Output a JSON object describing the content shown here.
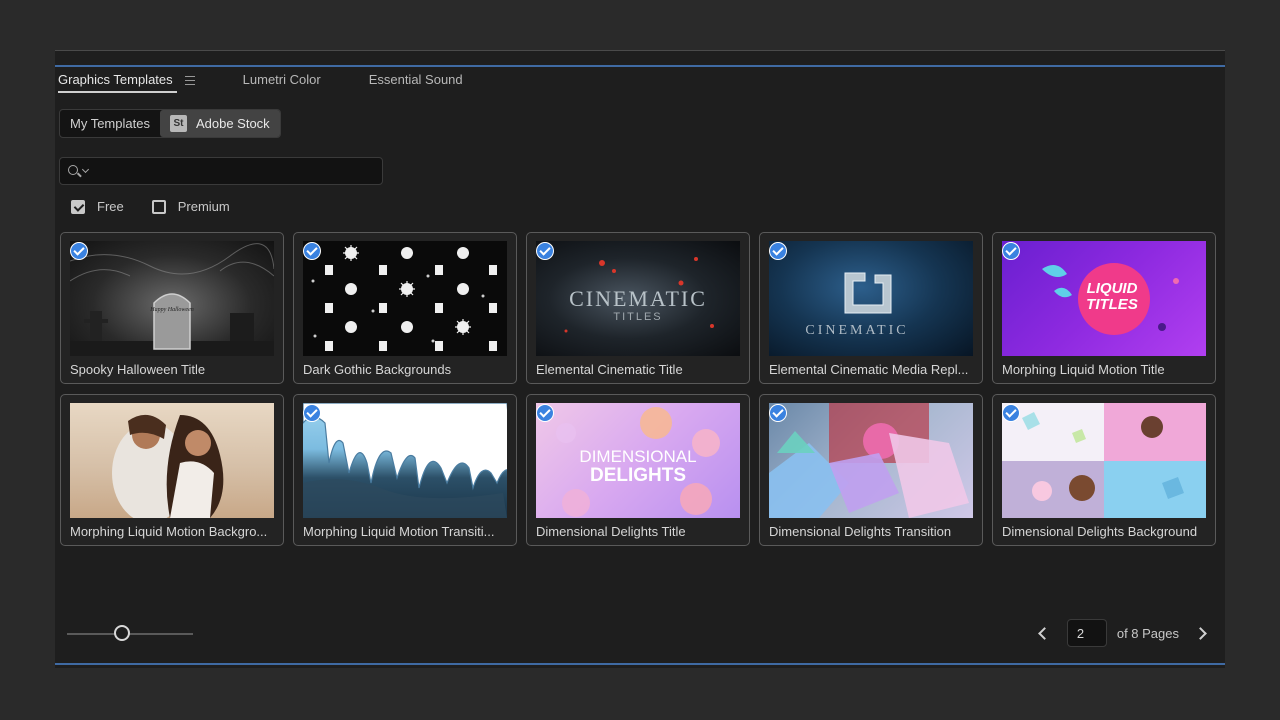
{
  "tabs": [
    {
      "label": "Graphics Templates"
    },
    {
      "label": "Lumetri Color"
    },
    {
      "label": "Essential Sound"
    }
  ],
  "source_toggle": {
    "my_templates": "My Templates",
    "adobe_stock_badge": "St",
    "adobe_stock": "Adobe Stock",
    "selected": "Adobe Stock"
  },
  "search": {
    "value": "",
    "placeholder": ""
  },
  "filters": {
    "free": {
      "label": "Free",
      "checked": true
    },
    "premium": {
      "label": "Premium",
      "checked": false
    }
  },
  "templates": [
    {
      "title": "Spooky Halloween Title",
      "selected": true,
      "thumb_text": "Happy Halloween"
    },
    {
      "title": "Dark Gothic Backgrounds",
      "selected": true
    },
    {
      "title": "Elemental Cinematic Title",
      "selected": true,
      "thumb_text": "CINEMATIC",
      "thumb_sub": "TITLES"
    },
    {
      "title": "Elemental Cinematic Media Repl...",
      "selected": true,
      "thumb_text": "CINEMATIC"
    },
    {
      "title": "Morphing Liquid Motion Title",
      "selected": true,
      "thumb_text": "LIQUID TITLES"
    },
    {
      "title": "Morphing Liquid Motion Backgro...",
      "selected": false
    },
    {
      "title": "Morphing Liquid Motion Transiti...",
      "selected": true
    },
    {
      "title": "Dimensional Delights Title",
      "selected": true,
      "thumb_text": "DIMENSIONAL",
      "thumb_sub": "DELIGHTS"
    },
    {
      "title": "Dimensional Delights Transition",
      "selected": true
    },
    {
      "title": "Dimensional Delights Background",
      "selected": true
    }
  ],
  "thumbnail_size_slider": {
    "value": 0.4
  },
  "pagination": {
    "current_page": "2",
    "of_label": "of 8 Pages"
  }
}
